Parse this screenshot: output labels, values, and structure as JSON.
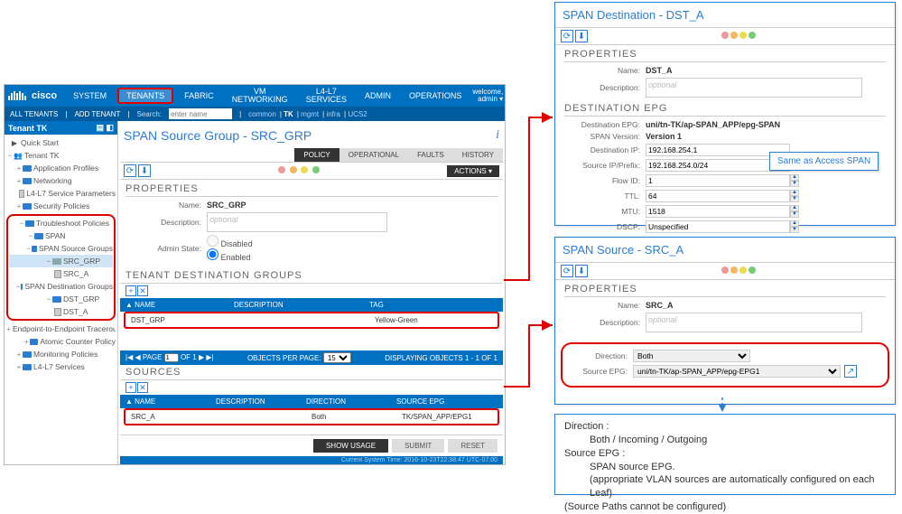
{
  "topnav": {
    "brand": "cisco",
    "items": [
      "SYSTEM",
      "TENANTS",
      "FABRIC",
      "VM NETWORKING",
      "L4-L7 SERVICES",
      "ADMIN",
      "OPERATIONS"
    ],
    "welcome1": "welcome,",
    "welcome2": "admin ▾"
  },
  "subbar": {
    "left1": "ALL TENANTS",
    "left2": "ADD TENANT",
    "searchlbl": "Search:",
    "placeholder": "enter name",
    "filters": [
      "common",
      "TK",
      "mgmt",
      "infra",
      "UCS2"
    ]
  },
  "sidebar": {
    "title": "Tenant TK",
    "quickstart": "Quick Start",
    "tenant": "Tenant TK",
    "approf": "Application Profiles",
    "networking": "Networking",
    "l4l7svc": "L4-L7 Service Parameters",
    "secpol": "Security Policies",
    "troubleshoot": "Troubleshoot Policies",
    "span": "SPAN",
    "src_groups": "SPAN Source Groups",
    "src_grp": "SRC_GRP",
    "src_a": "SRC_A",
    "dst_groups": "SPAN Destination Groups",
    "dst_grp": "DST_GRP",
    "dst_a": "DST_A",
    "e2e": "Endpoint-to-Endpoint Traceroute Pol...",
    "atomic": "Atomic Counter Policy",
    "monitoring": "Monitoring Policies",
    "l4l7": "L4-L7 Services"
  },
  "main": {
    "title": "SPAN Source Group - SRC_GRP",
    "tabs": [
      "POLICY",
      "OPERATIONAL",
      "FAULTS",
      "HISTORY"
    ],
    "actions": "ACTIONS ▾",
    "props": "PROPERTIES",
    "name_lbl": "Name:",
    "name_val": "SRC_GRP",
    "desc_lbl": "Description:",
    "desc_ph": "optional",
    "admin_lbl": "Admin State:",
    "admin_disabled": "Disabled",
    "admin_enabled": "Enabled",
    "tdg": "TENANT DESTINATION GROUPS",
    "th_name": "▲ NAME",
    "th_desc": "DESCRIPTION",
    "th_tag": "TAG",
    "row_name": "DST_GRP",
    "row_desc": "",
    "row_tag": "Yellow-Green",
    "pager_page": "PAGE",
    "pager_of": "OF 1",
    "pager_obj": "OBJECTS PER PAGE:",
    "pager_disp": "DISPLAYING OBJECTS 1 - 1 OF 1",
    "sources": "SOURCES",
    "sh_name": "▲ NAME",
    "sh_desc": "DESCRIPTION",
    "sh_dir": "DIRECTION",
    "sh_epg": "SOURCE EPG",
    "srow_name": "SRC_A",
    "srow_desc": "",
    "srow_dir": "Both",
    "srow_epg": "TK/SPAN_APP/EPG1",
    "show_usage": "SHOW USAGE",
    "submit": "SUBMIT",
    "reset": "RESET",
    "systime": "Current System Time: 2016-10-23T22:38:47 UTC-07:00"
  },
  "dest": {
    "title": "SPAN Destination - DST_A",
    "props": "PROPERTIES",
    "name_lbl": "Name:",
    "name_val": "DST_A",
    "desc_lbl": "Description:",
    "desc_ph": "optional",
    "section": "DESTINATION EPG",
    "depg_lbl": "Destination EPG:",
    "depg_val": "uni/tn-TK/ap-SPAN_APP/epg-SPAN",
    "ver_lbl": "SPAN Version:",
    "ver_val": "Version 1",
    "dip_lbl": "Destination IP:",
    "dip_val": "192.168.254.1",
    "sip_lbl": "Source IP/Prefix:",
    "sip_val": "192.168.254.0/24",
    "flow_lbl": "Flow ID:",
    "flow_val": "1",
    "ttl_lbl": "TTL:",
    "ttl_val": "64",
    "mtu_lbl": "MTU:",
    "mtu_val": "1518",
    "dscp_lbl": "DSCP:",
    "dscp_val": "Unspecified"
  },
  "callout_same": "Same as Access SPAN",
  "src": {
    "title": "SPAN Source - SRC_A",
    "props": "PROPERTIES",
    "name_lbl": "Name:",
    "name_val": "SRC_A",
    "desc_lbl": "Description:",
    "desc_ph": "optional",
    "dir_lbl": "Direction:",
    "dir_val": "Both",
    "sepg_lbl": "Source EPG:",
    "sepg_val": "uni/tn-TK/ap-SPAN_APP/epg-EPG1"
  },
  "note": {
    "l1": "Direction :",
    "l2": "Both / Incoming / Outgoing",
    "l3": "Source EPG :",
    "l4": "SPAN source EPG.",
    "l5": "(appropriate VLAN sources are automatically configured on each Leaf)",
    "l6": "(Source Paths cannot be configured)"
  }
}
